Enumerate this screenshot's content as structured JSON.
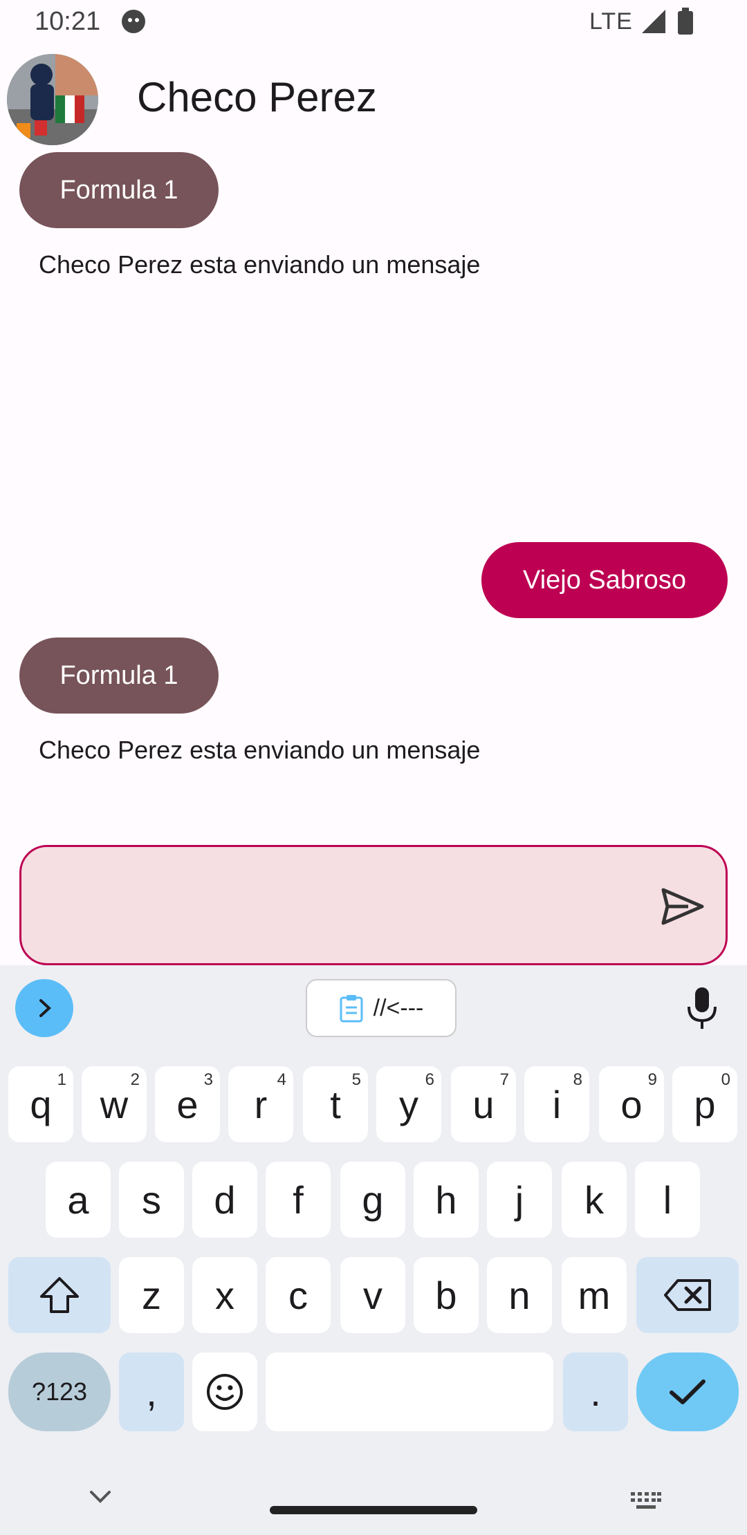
{
  "status_bar": {
    "time": "10:21",
    "network": "LTE"
  },
  "header": {
    "contact_name": "Checo Perez"
  },
  "messages": [
    {
      "type": "incoming",
      "text": "Formula 1"
    },
    {
      "type": "status",
      "text": "Checo Perez esta enviando un mensaje"
    },
    {
      "type": "outgoing",
      "text": "Viejo Sabroso"
    },
    {
      "type": "incoming",
      "text": "Formula 1"
    },
    {
      "type": "status",
      "text": "Checo Perez esta enviando un mensaje"
    }
  ],
  "composer": {
    "value": ""
  },
  "keyboard": {
    "clipboard_chip": "//<---",
    "row1": [
      {
        "k": "q",
        "h": "1"
      },
      {
        "k": "w",
        "h": "2"
      },
      {
        "k": "e",
        "h": "3"
      },
      {
        "k": "r",
        "h": "4"
      },
      {
        "k": "t",
        "h": "5"
      },
      {
        "k": "y",
        "h": "6"
      },
      {
        "k": "u",
        "h": "7"
      },
      {
        "k": "i",
        "h": "8"
      },
      {
        "k": "o",
        "h": "9"
      },
      {
        "k": "p",
        "h": "0"
      }
    ],
    "row2": [
      "a",
      "s",
      "d",
      "f",
      "g",
      "h",
      "j",
      "k",
      "l"
    ],
    "row3": [
      "z",
      "x",
      "c",
      "v",
      "b",
      "n",
      "m"
    ],
    "symbols_label": "?123",
    "comma": ",",
    "period": "."
  },
  "colors": {
    "incoming_bubble": "#775459",
    "outgoing_bubble": "#bd0052",
    "composer_border": "#bd0052"
  }
}
